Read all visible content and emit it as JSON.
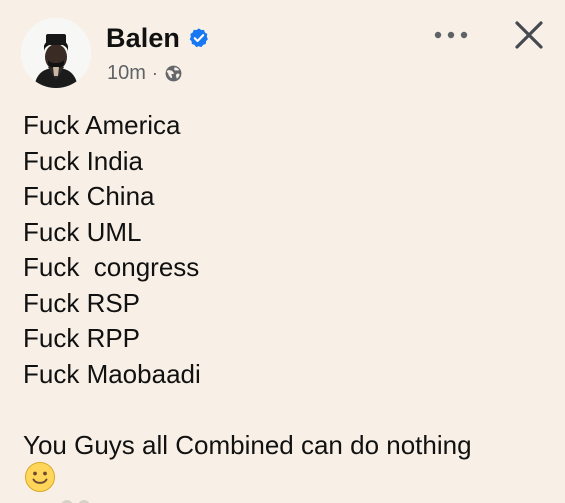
{
  "post": {
    "author": "Balen",
    "timestamp": "10m",
    "separator": "·",
    "lines": [
      "Fuck America",
      "Fuck India",
      "Fuck China",
      "Fuck UML",
      "Fuck  congress",
      "Fuck RSP",
      "Fuck RPP",
      "Fuck Maobaadi"
    ],
    "closing_line": "You Guys all Combined can do nothing"
  },
  "icons": {
    "verified": "verified-badge-icon",
    "privacy": "globe-icon",
    "more": "more-options-icon",
    "close": "close-icon",
    "emoji": "smiling-face-icon"
  },
  "colors": {
    "background": "#f8f0e6",
    "verified_blue": "#1877f2",
    "text": "#111111",
    "muted": "#5f6368"
  }
}
